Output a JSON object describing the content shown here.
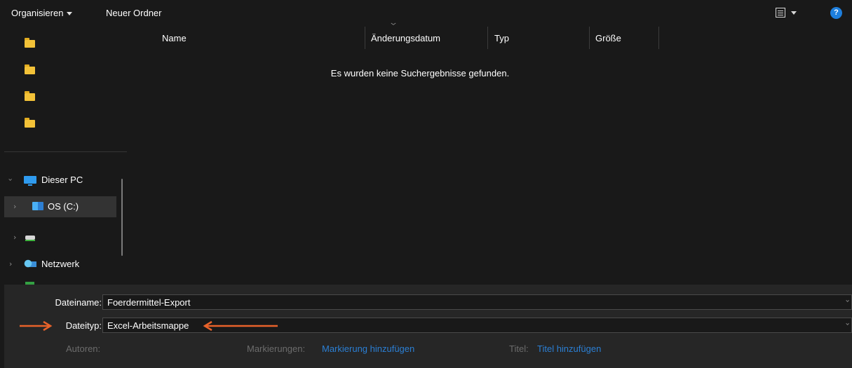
{
  "toolbar": {
    "organize_label": "Organisieren",
    "new_folder_label": "Neuer Ordner",
    "help_glyph": "?"
  },
  "nav": {
    "this_pc": "Dieser PC",
    "os_drive": "OS (C:)",
    "network": "Netzwerk"
  },
  "columns": {
    "name": "Name",
    "modified": "Änderungsdatum",
    "type": "Typ",
    "size": "Größe"
  },
  "content": {
    "empty_message": "Es wurden keine Suchergebnisse gefunden."
  },
  "form": {
    "filename_label": "Dateiname:",
    "filename_value": "Foerdermittel-Export",
    "filetype_label": "Dateityp:",
    "filetype_value": "Excel-Arbeitsmappe",
    "authors_label": "Autoren:",
    "tags_label": "Markierungen:",
    "tags_link": "Markierung hinzufügen",
    "title_label": "Titel:",
    "title_link": "Titel hinzufügen"
  },
  "colors": {
    "background": "#191919",
    "footer_background": "#262626",
    "accent_link": "#2b7fd4",
    "annotation_arrow": "#e8622a",
    "folder": "#f3c238"
  },
  "icons": [
    "folder-icon",
    "computer-icon",
    "os-drive-icon",
    "drive-icon",
    "network-icon",
    "view-options-icon",
    "help-icon",
    "chevron-down-icon",
    "chevron-right-icon",
    "arrow-annotation"
  ]
}
